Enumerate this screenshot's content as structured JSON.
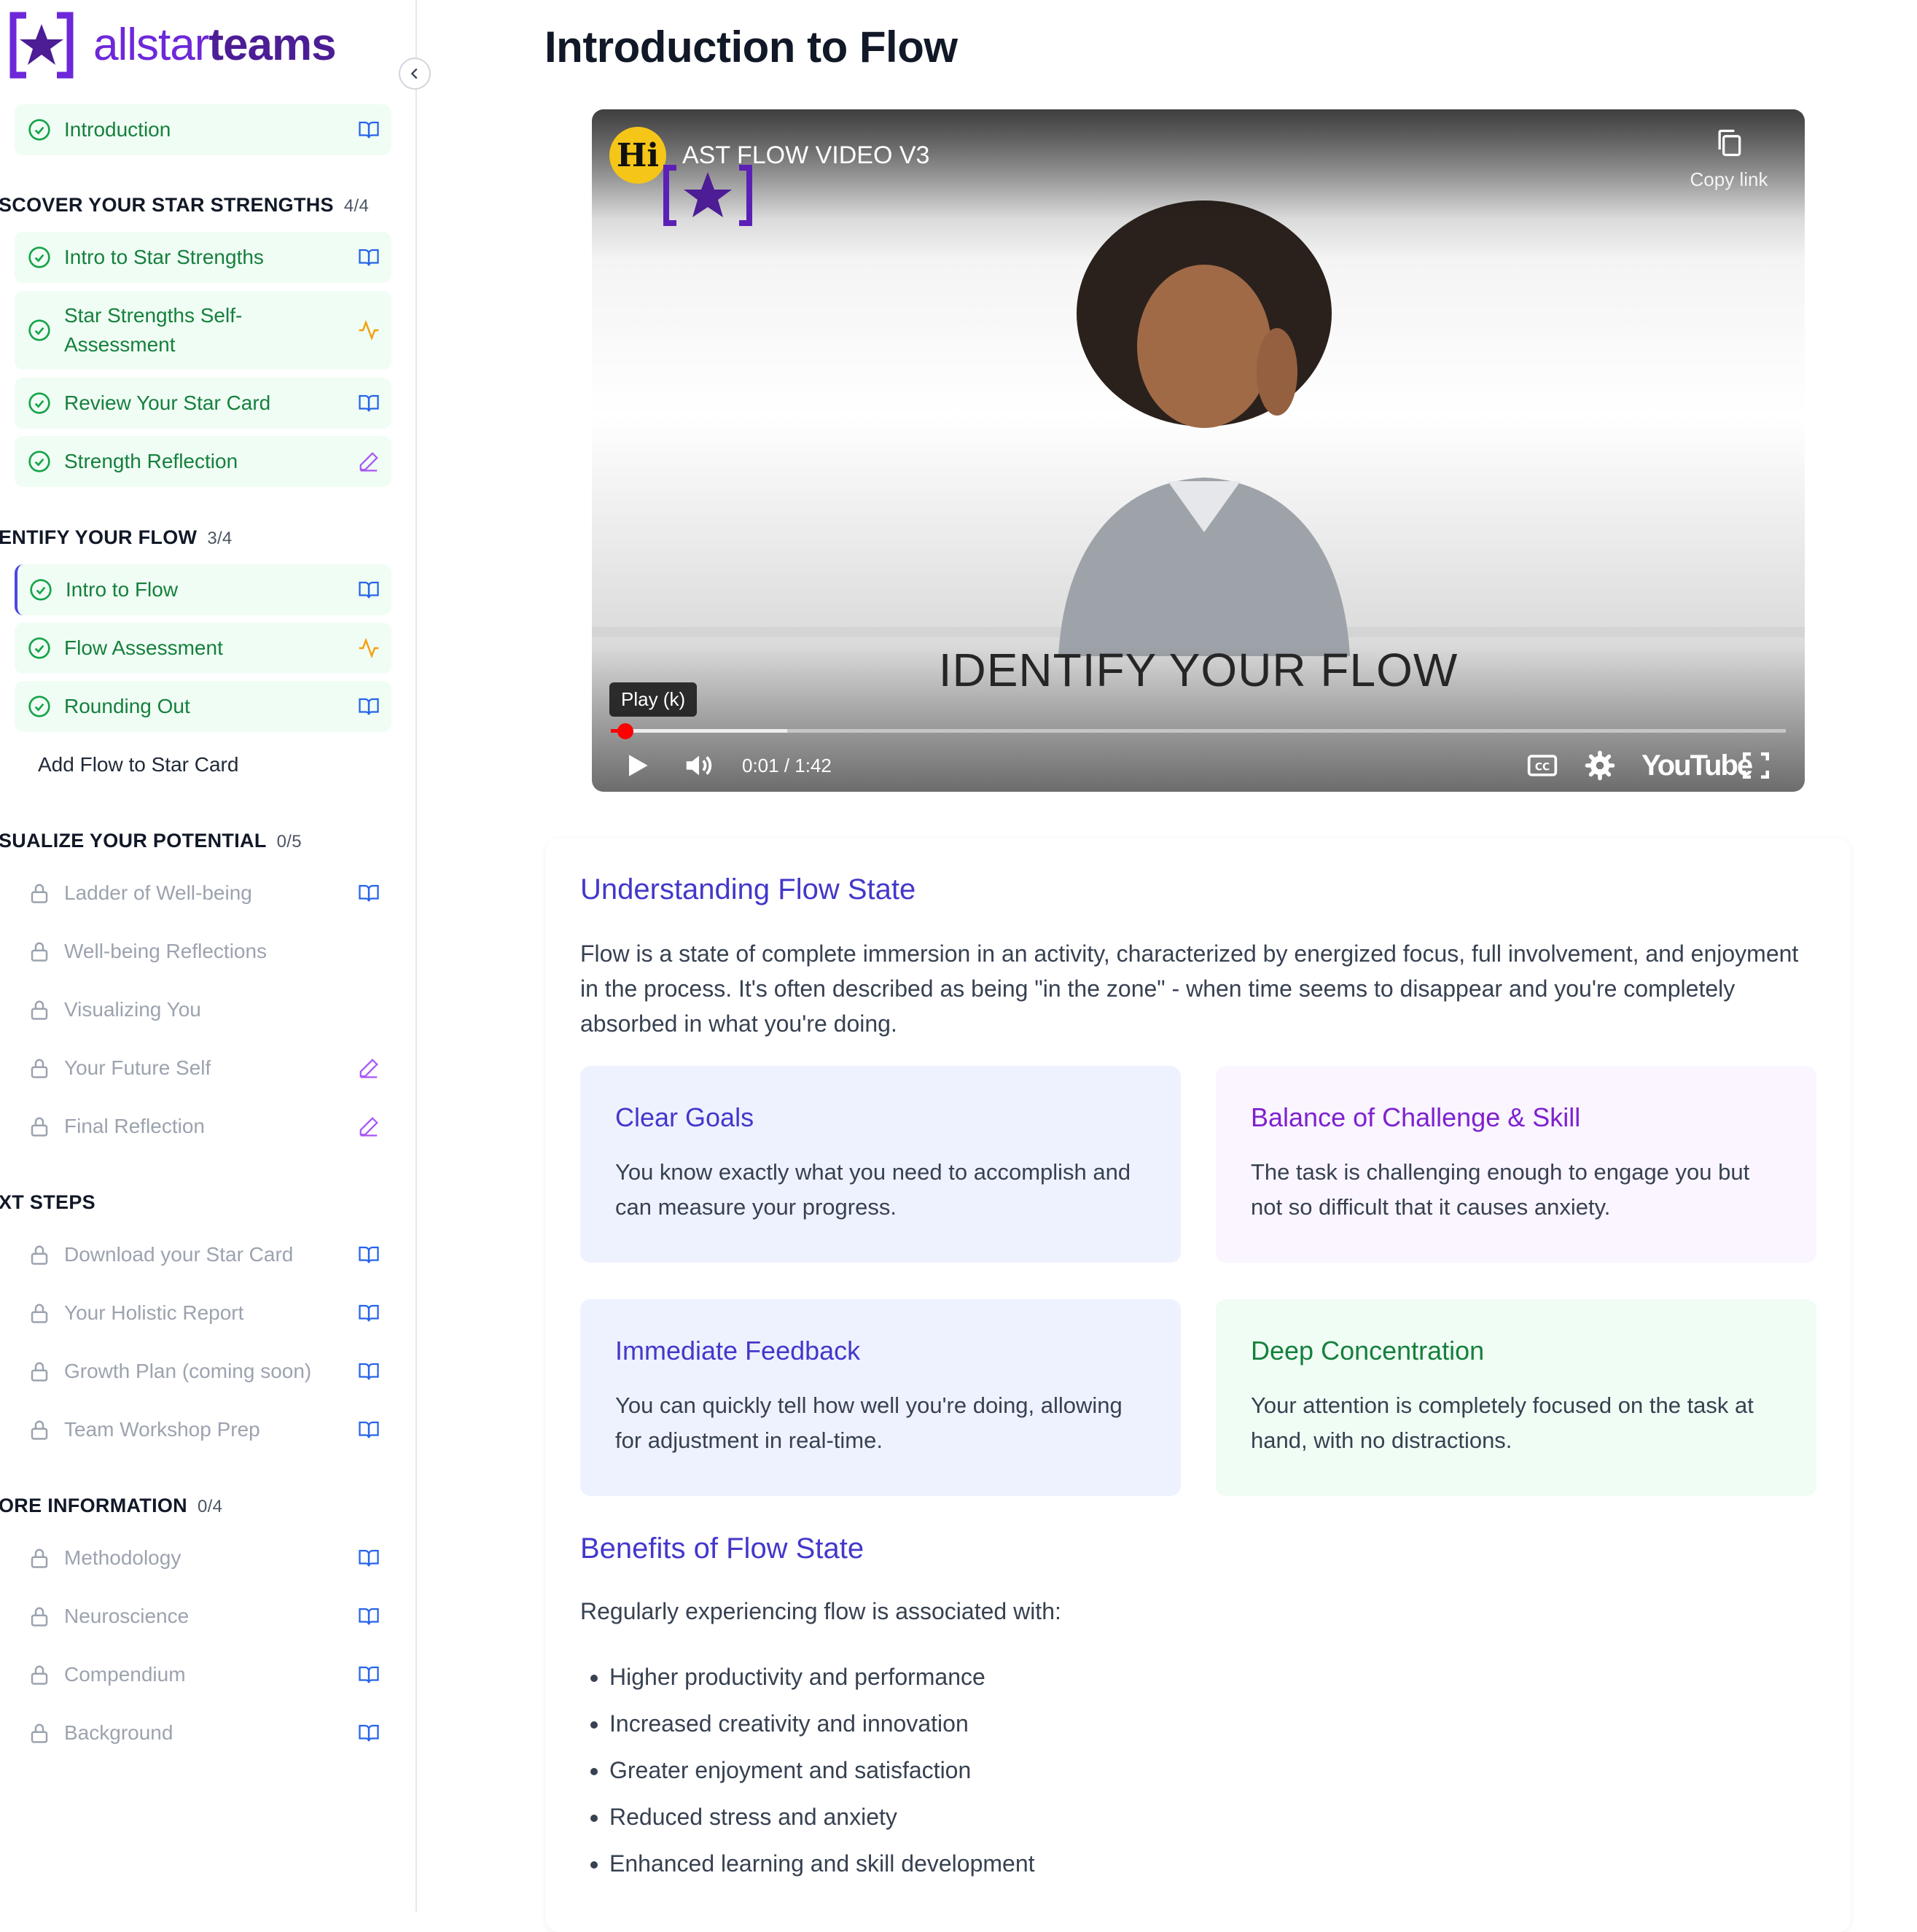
{
  "brand": {
    "name_part1": "allstar",
    "name_part2": "teams",
    "colors": {
      "primary": "#6d28d9",
      "dark": "#4c1d95",
      "success": "#16a34a",
      "warning": "#f59e0b",
      "locked": "#9ca3af"
    }
  },
  "sidebar": {
    "intro_item": {
      "label": "Introduction",
      "icon": "book-icon",
      "status": "completed"
    },
    "sections": [
      {
        "title": "SCOVER YOUR STAR STRENGTHS",
        "count": "4/4",
        "items": [
          {
            "label": "Intro to Star Strengths",
            "status": "completed",
            "icon": "book-icon"
          },
          {
            "label": "Star Strengths Self-Assessment",
            "status": "completed",
            "icon": "activity-icon"
          },
          {
            "label": "Review Your Star Card",
            "status": "completed",
            "icon": "book-icon"
          },
          {
            "label": "Strength Reflection",
            "status": "completed",
            "icon": "pencil-icon"
          }
        ]
      },
      {
        "title": "ENTIFY YOUR FLOW",
        "count": "3/4",
        "items": [
          {
            "label": "Intro to Flow",
            "status": "completed",
            "icon": "book-icon",
            "active": true
          },
          {
            "label": "Flow Assessment",
            "status": "completed",
            "icon": "activity-icon"
          },
          {
            "label": "Rounding Out",
            "status": "completed",
            "icon": "book-icon"
          },
          {
            "label": "Add Flow to Star Card",
            "status": "available",
            "icon": ""
          }
        ]
      },
      {
        "title": "SUALIZE YOUR POTENTIAL",
        "count": "0/5",
        "items": [
          {
            "label": "Ladder of Well-being",
            "status": "locked",
            "icon": "book-icon"
          },
          {
            "label": "Well-being Reflections",
            "status": "locked",
            "icon": ""
          },
          {
            "label": "Visualizing You",
            "status": "locked",
            "icon": ""
          },
          {
            "label": "Your Future Self",
            "status": "locked",
            "icon": "pencil-icon"
          },
          {
            "label": "Final Reflection",
            "status": "locked",
            "icon": "pencil-icon"
          }
        ]
      },
      {
        "title": "XT STEPS",
        "count": "",
        "items": [
          {
            "label": "Download your Star Card",
            "status": "locked",
            "icon": "book-icon"
          },
          {
            "label": "Your Holistic Report",
            "status": "locked",
            "icon": "book-icon"
          },
          {
            "label": "Growth Plan (coming soon)",
            "status": "locked",
            "icon": "book-icon"
          },
          {
            "label": "Team Workshop Prep",
            "status": "locked",
            "icon": "book-icon"
          }
        ]
      },
      {
        "title": "ORE INFORMATION",
        "count": "0/4",
        "items": [
          {
            "label": "Methodology",
            "status": "locked",
            "icon": "book-icon"
          },
          {
            "label": "Neuroscience",
            "status": "locked",
            "icon": "book-icon"
          },
          {
            "label": "Compendium",
            "status": "locked",
            "icon": "book-icon"
          },
          {
            "label": "Background",
            "status": "locked",
            "icon": "book-icon"
          }
        ]
      }
    ]
  },
  "main": {
    "title": "Introduction to Flow",
    "video": {
      "channel_avatar": "Hi",
      "title": "AST FLOW VIDEO V3",
      "copy_link_label": "Copy link",
      "caption": "IDENTIFY YOUR FLOW",
      "tooltip": "Play (k)",
      "time": "0:01 / 1:42",
      "played_fraction": 0.01,
      "buffered_fraction": 0.15,
      "youtube_label": "YouTube"
    },
    "understanding": {
      "heading": "Understanding Flow State",
      "body": "Flow is a state of complete immersion in an activity, characterized by energized focus, full involvement, and enjoyment in the process. It's often described as being \"in the zone\" - when time seems to disappear and you're completely absorbed in what you're doing."
    },
    "features": [
      {
        "title": "Clear Goals",
        "desc": "You know exactly what you need to accomplish and can measure your progress.",
        "title_color": "#4338ca",
        "bg": "#eef2ff"
      },
      {
        "title": "Balance of Challenge & Skill",
        "desc": "The task is challenging enough to engage you but not so difficult that it causes anxiety.",
        "title_color": "#7e22ce",
        "bg": "#faf5ff"
      },
      {
        "title": "Immediate Feedback",
        "desc": "You can quickly tell how well you're doing, allowing for adjustment in real-time.",
        "title_color": "#4338ca",
        "bg": "#eef2ff"
      },
      {
        "title": "Deep Concentration",
        "desc": "Your attention is completely focused on the task at hand, with no distractions.",
        "title_color": "#15803d",
        "bg": "#f0fdf4"
      }
    ],
    "benefits": {
      "heading": "Benefits of Flow State",
      "intro": "Regularly experiencing flow is associated with:",
      "items": [
        "Higher productivity and performance",
        "Increased creativity and innovation",
        "Greater enjoyment and satisfaction",
        "Reduced stress and anxiety",
        "Enhanced learning and skill development"
      ]
    }
  }
}
